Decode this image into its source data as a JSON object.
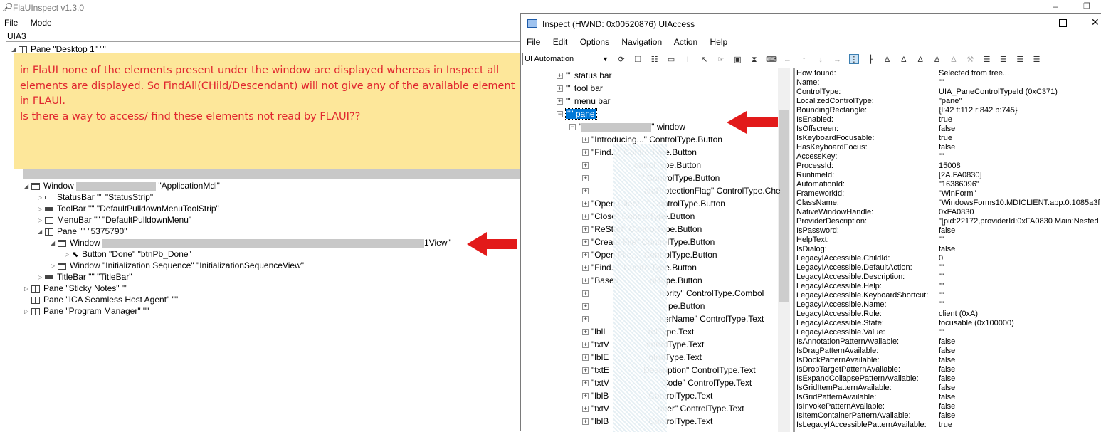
{
  "flaui": {
    "title": "FlaUInspect v1.3.0",
    "menu": [
      "File",
      "Mode"
    ],
    "mode_label": "UIA3",
    "tree": [
      "Pane \"Desktop 1\" \"\"",
      "Window",
      "\"ApplicationMdi\"",
      "StatusBar \"\" \"StatusStrip\"",
      "ToolBar \"\" \"DefaultPulldownMenuToolStrip\"",
      "MenuBar \"\" \"DefaultPulldownMenu\"",
      "Pane \"\" \"5375790\"",
      "Window",
      "1View\"",
      "Button \"Done\" \"btnPb_Done\"",
      "Window \"Initialization Sequence\" \"InitializationSequenceView\"",
      "TitleBar \"\" \"TitleBar\"",
      "Pane \"Sticky Notes\" \"\"",
      "Pane \"ICA Seamless Host Agent\" \"\"",
      "Pane \"Program Manager\" \"\""
    ],
    "note": "in FlaUI none of the elements present under the window are displayed whereas in Inspect all elements are displayed. So FindAll(CHild/Descendant) will not give any of the available element in FLAUI.\nIs there a way to access/ find these elements not read by FLAUI??"
  },
  "inspect": {
    "title": "Inspect  (HWND: 0x00520876) UIAccess",
    "menu": [
      "File",
      "Edit",
      "Options",
      "Navigation",
      "Action",
      "Help"
    ],
    "mode_select": "UI Automation",
    "tree": [
      "\"\" status bar",
      "\"\" tool bar",
      "\"\" menu bar",
      "\"\" pane",
      "\" window",
      "\"Introducing...\" ControlType.Button",
      "\"Find...\" ControlType.Button",
      "ontrolType.Button",
      "\" ControlType.Button",
      "ataProtectionFlag\" ControlType.Che",
      "\"Open Client...\" ControlType.Button",
      "\"Close\" ControlType.Button",
      "\"ReStart\" ControlType.Button",
      "\"Create File\" ControlType.Button",
      "\"Open File...\" ControlType.Button",
      "\"Find...\" ControlType.Button",
      "\"Based",
      "olType.Button",
      "hority\" ControlType.Combol",
      "pe.Button",
      "kerName\" ControlType.Text",
      "\"lblI",
      "rolType.Text",
      "\"txtV",
      "ontrolType.Text",
      "\"lblE",
      "ntrolType.Text",
      "\"txtE",
      "Description\" ControlType.Text",
      "\"txtV",
      "Code\" ControlType.Text",
      "\"lblB",
      "ControlType.Text",
      "\"txtV",
      "nber\" ControlType.Text",
      "\"lblB",
      "ControlType.Text"
    ],
    "properties": [
      [
        "How found:",
        "Selected from tree..."
      ],
      [
        "Name:",
        "\"\""
      ],
      [
        "ControlType:",
        "UIA_PaneControlTypeId (0xC371)"
      ],
      [
        "LocalizedControlType:",
        "\"pane\""
      ],
      [
        "BoundingRectangle:",
        "{l:42 t:112 r:842 b:745}"
      ],
      [
        "IsEnabled:",
        "true"
      ],
      [
        "IsOffscreen:",
        "false"
      ],
      [
        "IsKeyboardFocusable:",
        "true"
      ],
      [
        "HasKeyboardFocus:",
        "false"
      ],
      [
        "AccessKey:",
        "\"\""
      ],
      [
        "ProcessId:",
        "15008"
      ],
      [
        "RuntimeId:",
        "[2A.FA0830]"
      ],
      [
        "AutomationId:",
        "\"16386096\""
      ],
      [
        "FrameworkId:",
        "\"WinForm\""
      ],
      [
        "ClassName:",
        "\"WindowsForms10.MDICLIENT.app.0.1085a3f"
      ],
      [
        "NativeWindowHandle:",
        "0xFA0830"
      ],
      [
        "ProviderDescription:",
        "\"[pid:22172,providerId:0xFA0830 Main:Nested"
      ],
      [
        "IsPassword:",
        "false"
      ],
      [
        "HelpText:",
        "\"\""
      ],
      [
        "IsDialog:",
        "false"
      ],
      [
        "LegacyIAccessible.ChildId:",
        "0"
      ],
      [
        "LegacyIAccessible.DefaultAction:",
        "\"\""
      ],
      [
        "LegacyIAccessible.Description:",
        "\"\""
      ],
      [
        "LegacyIAccessible.Help:",
        "\"\""
      ],
      [
        "LegacyIAccessible.KeyboardShortcut:",
        "\"\""
      ],
      [
        "LegacyIAccessible.Name:",
        "\"\""
      ],
      [
        "LegacyIAccessible.Role:",
        "client (0xA)"
      ],
      [
        "LegacyIAccessible.State:",
        "focusable (0x100000)"
      ],
      [
        "LegacyIAccessible.Value:",
        "\"\""
      ],
      [
        "IsAnnotationPatternAvailable:",
        "false"
      ],
      [
        "IsDragPatternAvailable:",
        "false"
      ],
      [
        "IsDockPatternAvailable:",
        "false"
      ],
      [
        "IsDropTargetPatternAvailable:",
        "false"
      ],
      [
        "IsExpandCollapsePatternAvailable:",
        "false"
      ],
      [
        "IsGridItemPatternAvailable:",
        "false"
      ],
      [
        "IsGridPatternAvailable:",
        "false"
      ],
      [
        "IsInvokePatternAvailable:",
        "false"
      ],
      [
        "IsItemContainerPatternAvailable:",
        "false"
      ],
      [
        "IsLegacyIAccessiblePatternAvailable:",
        "true"
      ]
    ]
  },
  "colors": {
    "note_bg": "#fde79a",
    "note_text": "#e0262e",
    "selection": "#0078d7",
    "arrow": "#e21a1a"
  }
}
